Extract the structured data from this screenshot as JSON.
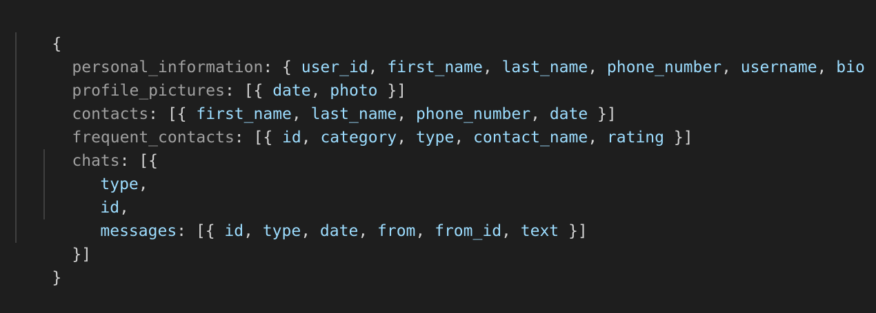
{
  "root": {
    "open": "{",
    "close": "}"
  },
  "lines": [
    {
      "key": "personal_information",
      "open": ": { ",
      "fields": [
        "user_id",
        "first_name",
        "last_name",
        "phone_number",
        "username",
        "bio"
      ],
      "close": " }"
    },
    {
      "key": "profile_pictures",
      "open": ": [{ ",
      "fields": [
        "date",
        "photo"
      ],
      "close": " }]"
    },
    {
      "key": "contacts",
      "open": ": [{ ",
      "fields": [
        "first_name",
        "last_name",
        "phone_number",
        "date"
      ],
      "close": " }]"
    },
    {
      "key": "frequent_contacts",
      "open": ": [{ ",
      "fields": [
        "id",
        "category",
        "type",
        "contact_name",
        "rating"
      ],
      "close": " }]"
    }
  ],
  "chats": {
    "key": "chats",
    "open": ": [{",
    "items": [
      "type",
      "id"
    ],
    "messages": {
      "key": "messages",
      "open": ": [{ ",
      "fields": [
        "id",
        "type",
        "date",
        "from",
        "from_id",
        "text"
      ],
      "close": " }]"
    },
    "close": "}]"
  },
  "colors": {
    "background": "#1e1e1e",
    "key": "#a0a0a0",
    "field": "#9cdcfe",
    "punctuation": "#d4d4d4",
    "indent_guide": "#404040"
  }
}
